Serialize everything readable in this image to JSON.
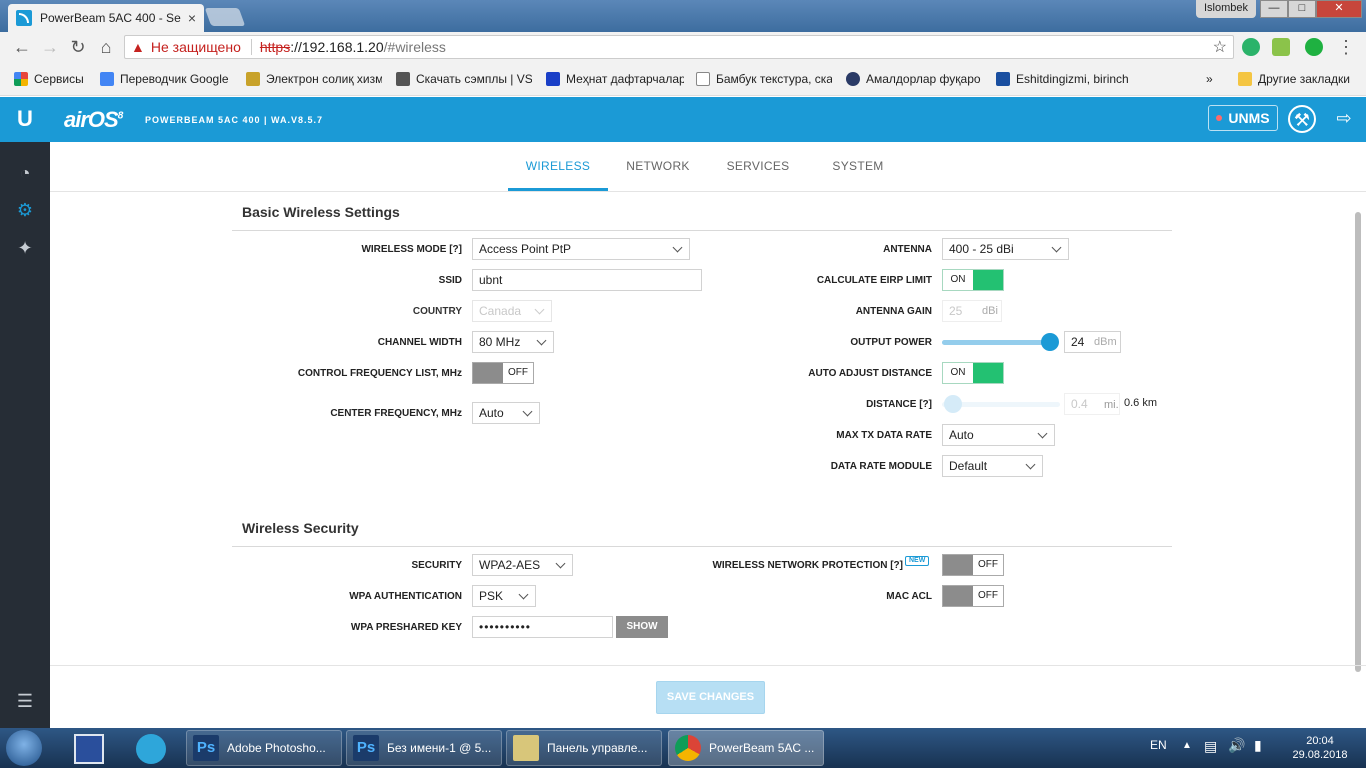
{
  "browser": {
    "tab_title": "PowerBeam 5AC 400 - Se",
    "tab_close": "×",
    "window_user": "Islombek",
    "security_warning": "Не защищено",
    "url_protocol": "https",
    "url_host": "://192.168.1.20",
    "url_path": "/#wireless",
    "bookmarks": [
      {
        "label": "Сервисы",
        "color": "#e8453c"
      },
      {
        "label": "Переводчик Google",
        "color": "#4285f4"
      },
      {
        "label": "Электрон солиқ хизм",
        "color": "#c8a22a"
      },
      {
        "label": "Скачать сэмплы | VS",
        "color": "#555555"
      },
      {
        "label": "Меҳнат дафтарчалар",
        "color": "#1a3fc7"
      },
      {
        "label": "Бамбук текстура, ска",
        "color": "#888888"
      },
      {
        "label": "Амалдорлар фуқаро",
        "color": "#2a3a66"
      },
      {
        "label": "Eshitdingizmi, birinch",
        "color": "#1a4fa0"
      }
    ],
    "bookmarks_more": "»",
    "other_bookmarks": "Другие закладки"
  },
  "header": {
    "brand": "airOS",
    "brand_version": "8",
    "device_line": "POWERBEAM 5AC 400 | WA.V8.5.7",
    "unms_label": "UNMS"
  },
  "nav_tabs": [
    "WIRELESS",
    "NETWORK",
    "SERVICES",
    "SYSTEM"
  ],
  "basic": {
    "title": "Basic Wireless Settings",
    "wireless_mode_label": "WIRELESS MODE [?]",
    "wireless_mode_value": "Access Point PtP",
    "ssid_label": "SSID",
    "ssid_value": "ubnt",
    "country_label": "COUNTRY",
    "country_value": "Canada",
    "channel_width_label": "CHANNEL WIDTH",
    "channel_width_value": "80 MHz",
    "control_freq_label": "CONTROL FREQUENCY LIST, MHz",
    "control_freq_state": "OFF",
    "center_freq_label": "CENTER FREQUENCY, MHz",
    "center_freq_value": "Auto",
    "antenna_label": "ANTENNA",
    "antenna_value": "400 - 25 dBi",
    "calc_eirp_label": "CALCULATE EIRP LIMIT",
    "calc_eirp_state": "ON",
    "antenna_gain_label": "ANTENNA GAIN",
    "antenna_gain_value": "25",
    "antenna_gain_unit": "dBi",
    "output_power_label": "OUTPUT POWER",
    "output_power_value": "24",
    "output_power_unit": "dBm",
    "output_power_level": 0.95,
    "auto_adjust_label": "AUTO ADJUST DISTANCE",
    "auto_adjust_state": "ON",
    "distance_label": "DISTANCE [?]",
    "distance_value": "0.4",
    "distance_unit": "mi.",
    "distance_km": "0.6 km",
    "distance_level": 0.02,
    "max_tx_label": "MAX TX DATA RATE",
    "max_tx_value": "Auto",
    "rate_module_label": "DATA RATE MODULE",
    "rate_module_value": "Default"
  },
  "security": {
    "title": "Wireless Security",
    "security_label": "SECURITY",
    "security_value": "WPA2-AES",
    "wpa_auth_label": "WPA AUTHENTICATION",
    "wpa_auth_value": "PSK",
    "wpa_key_label": "WPA PRESHARED KEY",
    "wpa_key_value": "••••••••••",
    "show_label": "SHOW",
    "wnp_label": "WIRELESS NETWORK PROTECTION [?]",
    "wnp_badge": "NEW",
    "wnp_state": "OFF",
    "mac_acl_label": "MAC ACL",
    "mac_acl_state": "OFF"
  },
  "save_label": "SAVE CHANGES",
  "taskbar": {
    "items": [
      "Adobe Photosho...",
      "Без имени-1 @ 5...",
      "Панель управле...",
      "PowerBeam 5AC ..."
    ],
    "language": "EN",
    "time": "20:04",
    "date": "29.08.2018"
  },
  "colors": {
    "accent": "#1b9ad6",
    "toggle_on": "#23c172",
    "sidebar": "#262d36"
  }
}
